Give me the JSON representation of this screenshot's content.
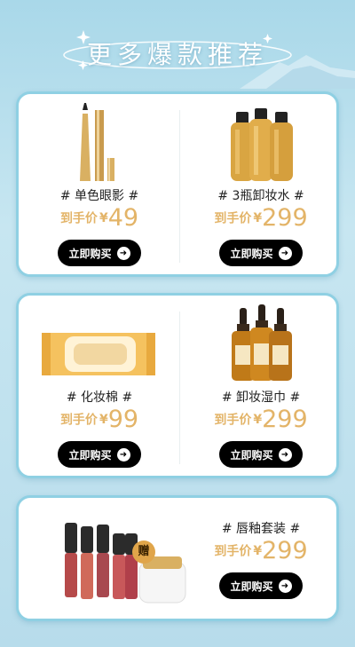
{
  "header": {
    "title": "更多爆款推荐"
  },
  "colors": {
    "accent_gold": "#e3b468",
    "button_bg": "#000000",
    "card_border": "#8fd0e3"
  },
  "products": [
    {
      "name": "# 单色眼影 #",
      "price_label": "到手价",
      "currency": "¥",
      "price": "49",
      "button": "立即购买",
      "icon": "eyeliner-pencil-icon"
    },
    {
      "name": "# 3瓶卸妆水 #",
      "price_label": "到手价",
      "currency": "¥",
      "price": "299",
      "button": "立即购买",
      "icon": "makeup-remover-bottles-icon"
    },
    {
      "name": "# 化妆棉 #",
      "price_label": "到手价",
      "currency": "¥",
      "price": "99",
      "button": "立即购买",
      "icon": "wipes-pack-icon"
    },
    {
      "name": "# 卸妆湿巾 #",
      "price_label": "到手价",
      "currency": "¥",
      "price": "299",
      "button": "立即购买",
      "icon": "dropper-bottles-icon"
    },
    {
      "name": "# 唇釉套装 #",
      "price_label": "到手价",
      "currency": "¥",
      "price": "299",
      "button": "立即购买",
      "icon": "lip-gloss-set-icon",
      "badge": "赠"
    }
  ]
}
